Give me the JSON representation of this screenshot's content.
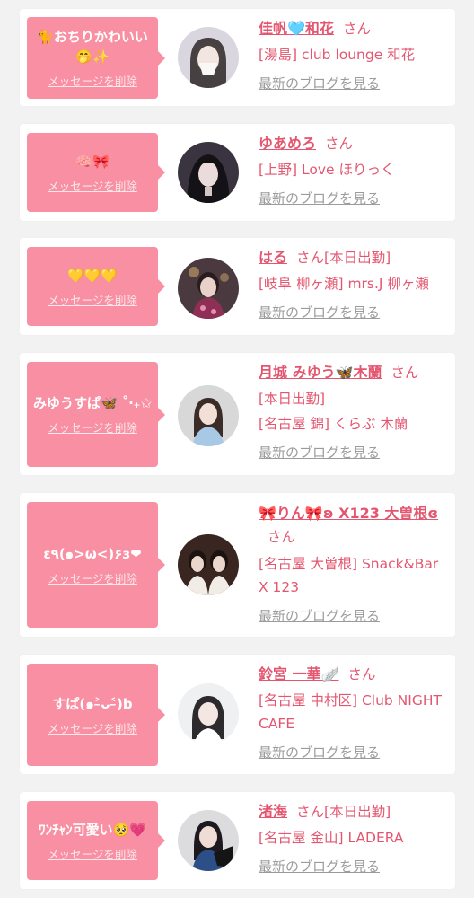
{
  "colors": {
    "accent": "#e4566f",
    "bubble": "#f88fa2",
    "link_gray": "#9b9b9b",
    "background": "#f2f2f2"
  },
  "delete_label": "メッセージを削除",
  "san_label": "さん",
  "blog_label": "最新のブログを見る",
  "items": [
    {
      "message": "🐈おちりかわいい🤭✨",
      "name": "佳帆🩵和花",
      "tag": "",
      "shop": "[湯島] club lounge 和花"
    },
    {
      "message": "🧠🎀",
      "name": "ゆあめろ",
      "tag": "",
      "shop": "[上野] Love ほりっく"
    },
    {
      "message": "💛💛💛",
      "name": "はる",
      "tag": "[本日出勤]",
      "shop": "[岐阜 柳ヶ瀬] mrs.J 柳ヶ瀬"
    },
    {
      "message": "みゆうすぱ🦋 ˚‧₊✩",
      "name": "月城 みゆう🦋木蘭",
      "tag": "[本日出勤]",
      "shop": "[名古屋 錦] くらぶ 木蘭"
    },
    {
      "message": "ε٩(๑>ω<)۶з❤",
      "name": "🎀りん🎀ʚ X123 大曽根ɞ",
      "tag": "",
      "shop": "[名古屋 大曽根] Snack&Bar X 123"
    },
    {
      "message": "すぱ(๑˃̵ᴗ˂̵)b",
      "name": "鈴宮 一華🪽",
      "tag": "",
      "shop": "[名古屋 中村区] Club NIGHT CAFE"
    },
    {
      "message": "ﾜﾝﾁｬﾝ可愛い🥺💗",
      "name": "渚海",
      "tag": "[本日出勤]",
      "shop": "[名古屋 金山] LADERA"
    }
  ]
}
